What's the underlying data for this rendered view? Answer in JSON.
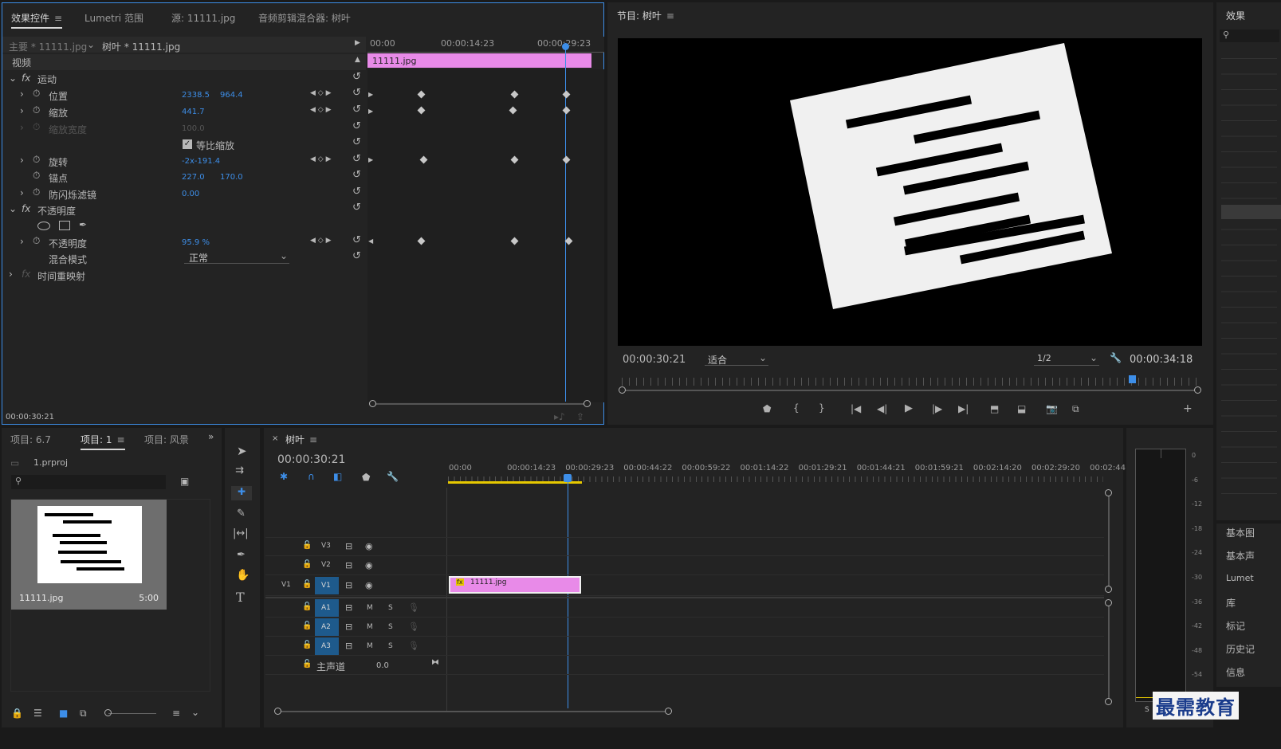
{
  "effect_controls": {
    "tabs": [
      "效果控件",
      "Lumetri 范围",
      "源: 11111.jpg",
      "音频剪辑混合器: 树叶"
    ],
    "master_label": "主要 * 11111.jpg",
    "seq_label": "树叶 * 11111.jpg",
    "video_label": "视频",
    "ruler": [
      "00:00",
      "00:00:14:23",
      "00:00:29:23"
    ],
    "clip_name": "11111.jpg",
    "motion": "运动",
    "position": {
      "label": "位置",
      "x": "2338.5",
      "y": "964.4"
    },
    "scale": {
      "label": "缩放",
      "value": "441.7"
    },
    "scale_width": {
      "label": "缩放宽度",
      "value": "100.0"
    },
    "uniform": "等比缩放",
    "rotation": {
      "label": "旋转",
      "value": "-2x-191.4"
    },
    "anchor": {
      "label": "锚点",
      "x": "227.0",
      "y": "170.0"
    },
    "flicker": {
      "label": "防闪烁滤镜",
      "value": "0.00"
    },
    "opacity_section": "不透明度",
    "opacity": {
      "label": "不透明度",
      "value": "95.9 %"
    },
    "blend": {
      "label": "混合模式",
      "value": "正常"
    },
    "time_remap": "时间重映射",
    "fx": "fx",
    "timecode": "00:00:30:21"
  },
  "program": {
    "title": "节目: 树叶",
    "timecode": "00:00:30:21",
    "fit": "适合",
    "quality": "1/2",
    "duration": "00:00:34:18"
  },
  "right_panel": {
    "title": "效果",
    "items": [
      "基本图",
      "基本声",
      "Lumet",
      "库",
      "标记",
      "历史记",
      "信息"
    ]
  },
  "project": {
    "tabs": [
      "项目: 6.7",
      "项目: 1",
      "项目: 风景"
    ],
    "file": "1.prproj",
    "thumb_name": "11111.jpg",
    "thumb_dur": "5:00"
  },
  "timeline": {
    "title": "树叶",
    "timecode": "00:00:30:21",
    "ruler": [
      "00:00",
      "00:00:14:23",
      "00:00:29:23",
      "00:00:44:22",
      "00:00:59:22",
      "00:01:14:22",
      "00:01:29:21",
      "00:01:44:21",
      "00:01:59:21",
      "00:02:14:20",
      "00:02:29:20",
      "00:02:44:"
    ],
    "tracks_video": [
      "V3",
      "V2",
      "V1"
    ],
    "tracks_audio": [
      "A1",
      "A2",
      "A3"
    ],
    "src_label": "V1",
    "mute": "M",
    "solo": "S",
    "master": "主声道",
    "master_val": "0.0",
    "clip": "11111.jpg"
  },
  "meter": {
    "ticks": [
      "0",
      "-6",
      "-12",
      "-18",
      "-24",
      "-30",
      "-36",
      "-42",
      "-48",
      "-54"
    ],
    "bottom": "S"
  },
  "watermark": "最需教育"
}
